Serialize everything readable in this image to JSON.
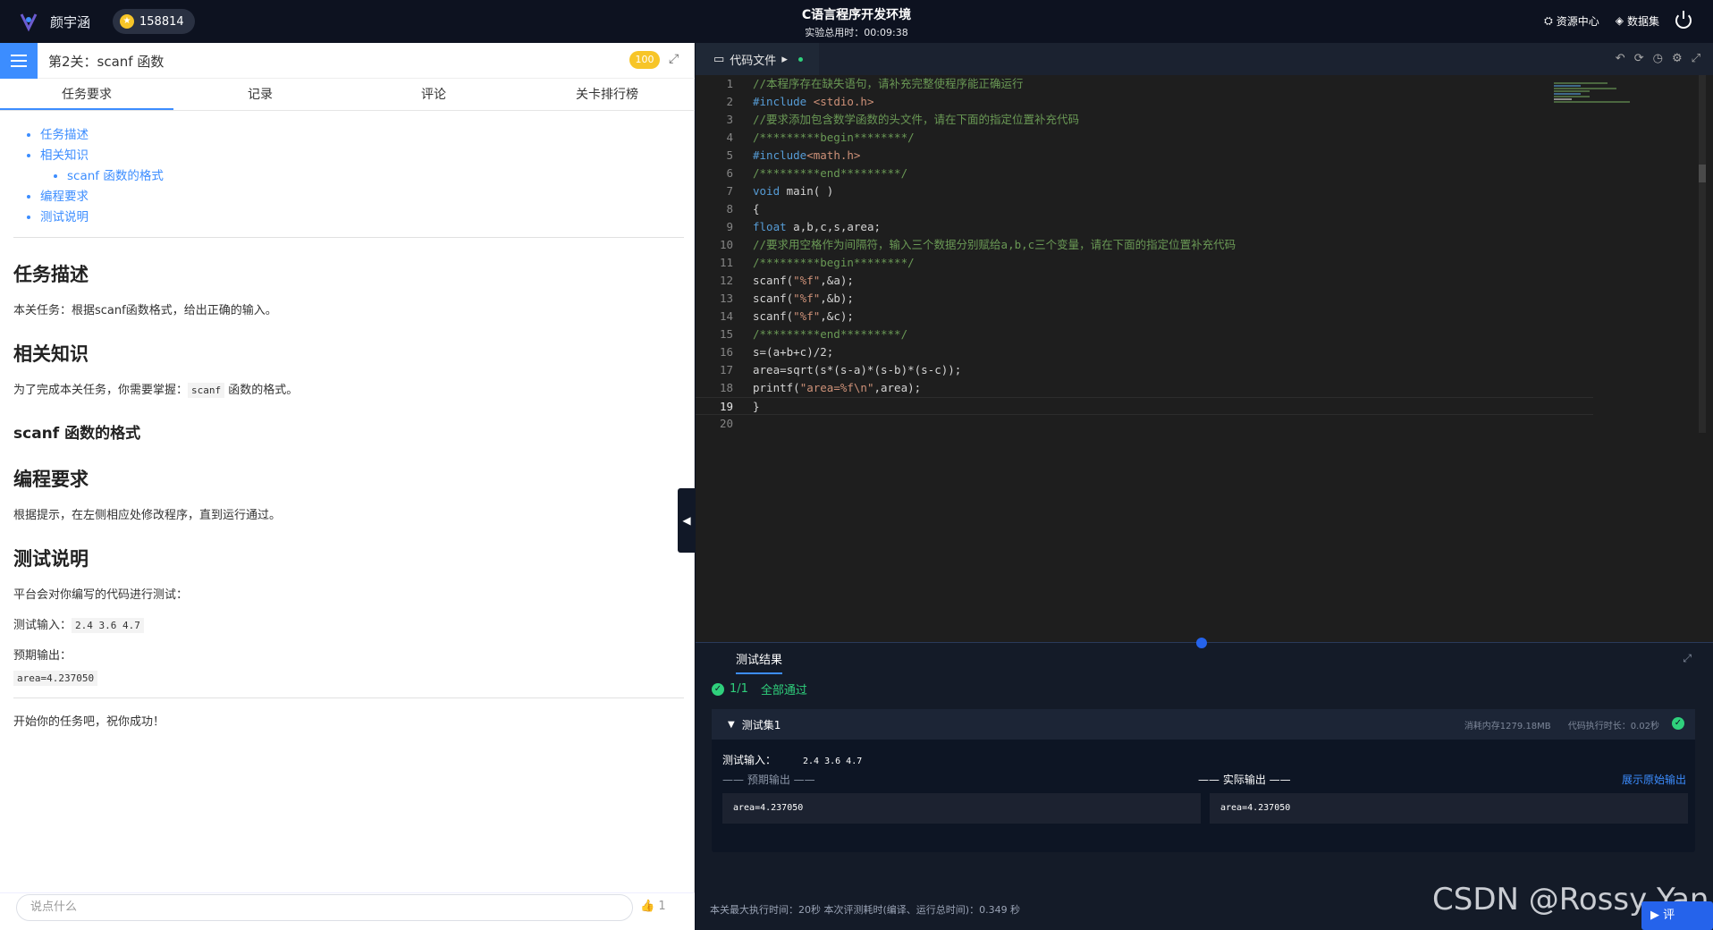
{
  "header": {
    "user_name": "颜宇涵",
    "coins": "158814",
    "title": "C语言程序开发环境",
    "time_label": "实验总用时：00:09:38",
    "resource_center": "资源中心",
    "dataset": "数据集"
  },
  "left": {
    "level_title": "第2关：scanf 函数",
    "score": "100",
    "tabs": [
      "任务要求",
      "记录",
      "评论",
      "关卡排行榜"
    ],
    "toc": [
      "任务描述",
      "相关知识",
      "scanf 函数的格式",
      "编程要求",
      "测试说明"
    ],
    "sections": {
      "task_title": "任务描述",
      "task_text": "本关任务：根据scanf函数格式，给出正确的输入。",
      "knowledge_title": "相关知识",
      "knowledge_text_pre": "为了完成本关任务，你需要掌握：",
      "knowledge_code": "scanf",
      "knowledge_text_post": " 函数的格式。",
      "scanf_title": "scanf 函数的格式",
      "req_title": "编程要求",
      "req_text": "根据提示，在左侧相应处修改程序，直到运行通过。",
      "test_title": "测试说明",
      "test_text": "平台会对你编写的代码进行测试：",
      "test_input_label": "测试输入：",
      "test_input": "2.4 3.6 4.7",
      "expected_label": "预期输出：",
      "expected": "area=4.237050",
      "start_text": "开始你的任务吧，祝你成功！"
    },
    "comment_placeholder": "说点什么",
    "likes": "1"
  },
  "editor": {
    "tab_label": "代码文件",
    "current_line": 19
  },
  "results": {
    "title": "测试结果",
    "pass_count": "1/1",
    "pass_text": "全部通过",
    "set_name": "测试集1",
    "memory": "消耗内存1279.18MB",
    "exec_time": "代码执行时长：0.02秒",
    "input_label": "测试输入：",
    "input_value": "2.4 3.6 4.7",
    "expected_label": "—— 预期输出 ——",
    "actual_label": "—— 实际输出 ——",
    "raw_link": "展示原始输出",
    "expected_value": "area=4.237050",
    "actual_value": "area=4.237050",
    "status": "本关最大执行时间：20秒    本次评测耗时(编译、运行总时间)：0.349 秒",
    "run_label": "评"
  },
  "watermark": "CSDN @Rossy Yan"
}
